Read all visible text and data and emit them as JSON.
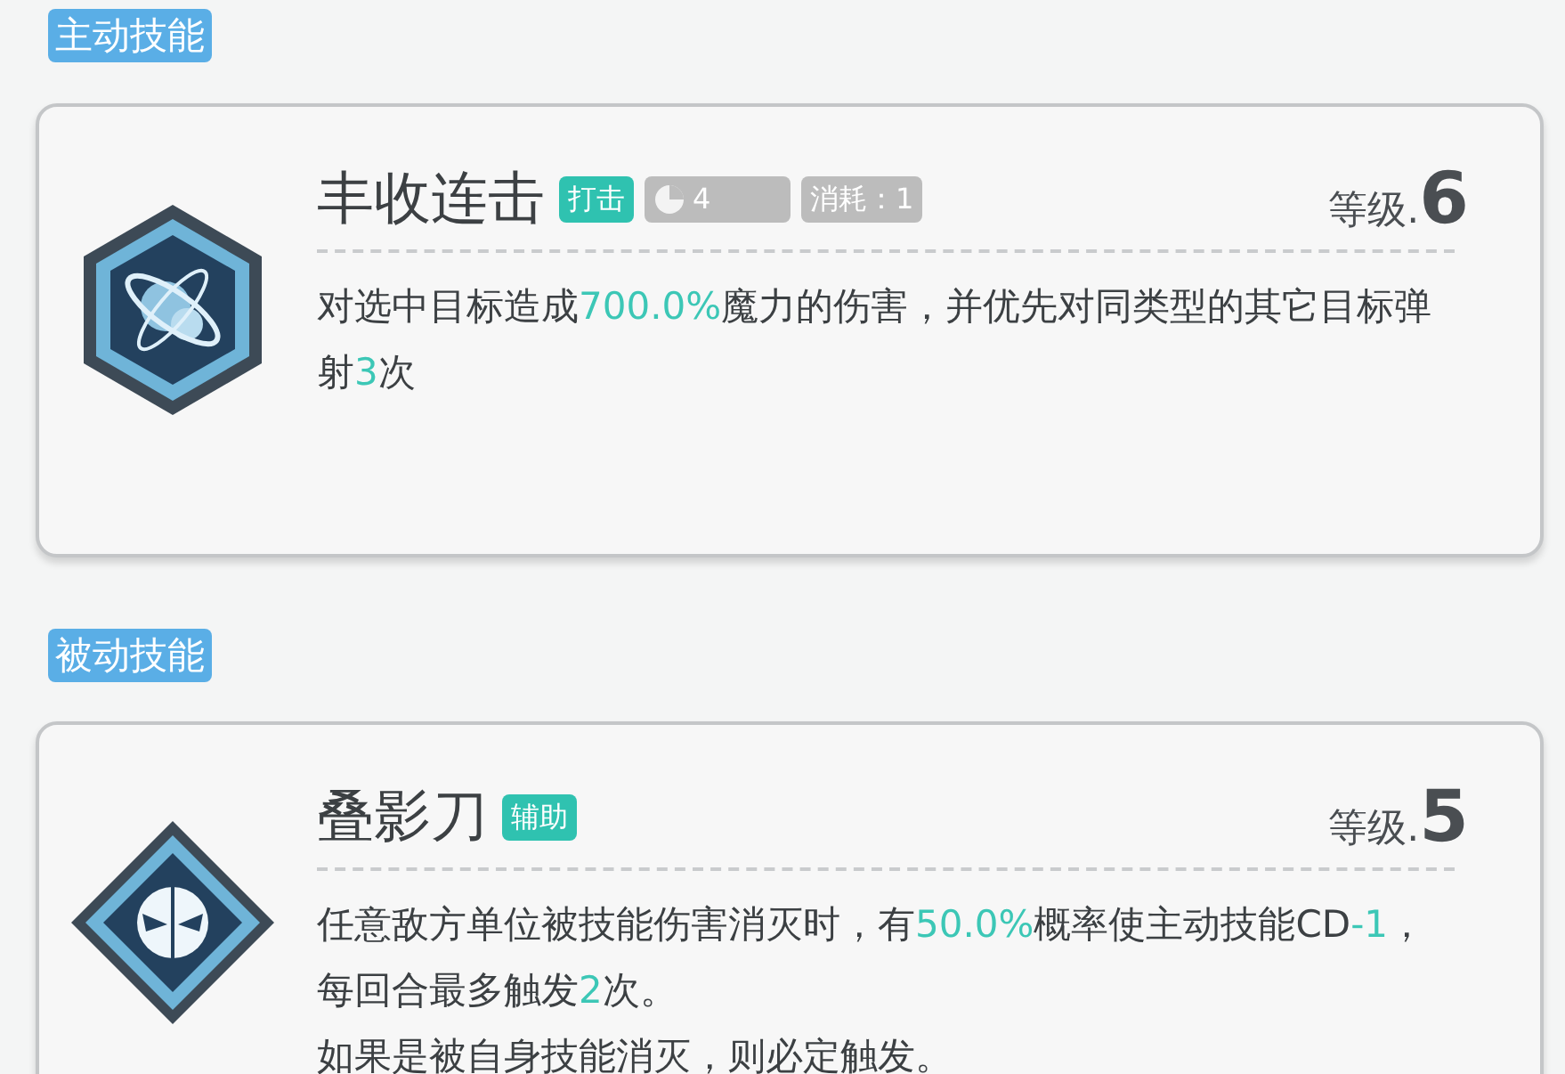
{
  "sections": [
    {
      "label": "主动技能",
      "skill": {
        "name": "丰收连击",
        "tags": [
          {
            "kind": "type",
            "text": "打击"
          },
          {
            "kind": "cooldown",
            "text": "4"
          },
          {
            "kind": "cost",
            "text": "消耗：1"
          }
        ],
        "level_label": "等级.",
        "level": "6",
        "paragraphs": [
          [
            {
              "text": "对选中目标造成",
              "highlight": false
            },
            {
              "text": "700.0%",
              "highlight": true
            },
            {
              "text": "魔力的伤害，并优先对同类型的其它目标弹射",
              "highlight": false
            },
            {
              "text": "3",
              "highlight": true
            },
            {
              "text": "次",
              "highlight": false
            }
          ]
        ]
      }
    },
    {
      "label": "被动技能",
      "skill": {
        "name": "叠影刀",
        "tags": [
          {
            "kind": "type",
            "text": "辅助"
          }
        ],
        "level_label": "等级.",
        "level": "5",
        "paragraphs": [
          [
            {
              "text": "任意敌方单位被技能伤害消灭时，有",
              "highlight": false
            },
            {
              "text": "50.0%",
              "highlight": true
            },
            {
              "text": "概率使主动技能CD",
              "highlight": false
            },
            {
              "text": "-1",
              "highlight": true
            },
            {
              "text": "，每回合最多触发",
              "highlight": false
            },
            {
              "text": "2",
              "highlight": true
            },
            {
              "text": "次。",
              "highlight": false
            }
          ],
          [
            {
              "text": "如果是被自身技能消灭，则必定触发。",
              "highlight": false
            }
          ]
        ]
      }
    }
  ]
}
